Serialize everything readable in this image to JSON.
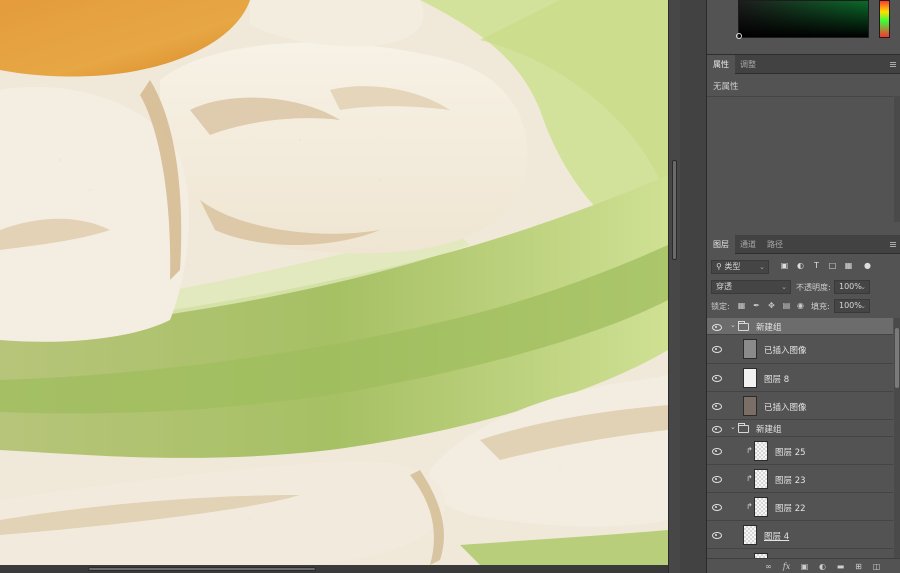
{
  "colors": {
    "panel_bg": "#535353",
    "tab_bar_bg": "#424242",
    "selected_row": "#6c6c6c"
  },
  "properties_panel": {
    "tabs": [
      {
        "label": "属性",
        "active": true
      },
      {
        "label": "调整",
        "active": false
      }
    ],
    "empty_text": "无属性"
  },
  "layers_panel": {
    "tabs": [
      {
        "label": "图层",
        "active": true
      },
      {
        "label": "通道",
        "active": false
      },
      {
        "label": "路径",
        "active": false
      }
    ],
    "filter_kind": "类型",
    "filter_icons": [
      "image-filter-icon",
      "adjustment-filter-icon",
      "type-filter-icon",
      "shape-filter-icon",
      "smart-object-filter-icon",
      "filter-toggle-icon"
    ],
    "blend_mode": "穿透",
    "opacity_label": "不透明度:",
    "opacity_value": "100%",
    "lock_label": "锁定:",
    "lock_icons": [
      "lock-transparent-icon",
      "lock-image-icon",
      "lock-position-icon",
      "lock-artboard-icon",
      "lock-all-icon"
    ],
    "fill_label": "填充:",
    "fill_value": "100%",
    "layers": [
      {
        "name": "新建组",
        "type": "group",
        "expanded": true,
        "selected": true
      },
      {
        "name": "已插入图像",
        "type": "image",
        "thumb": "#8a8a8a"
      },
      {
        "name": "图层 8",
        "type": "image",
        "thumb": "#f2f2f2"
      },
      {
        "name": "已插入图像",
        "type": "image",
        "thumb": "#7a6e66"
      },
      {
        "name": "新建组",
        "type": "group",
        "expanded": true
      },
      {
        "name": "图层 25",
        "type": "clipped"
      },
      {
        "name": "图层 23",
        "type": "clipped"
      },
      {
        "name": "图层 22",
        "type": "clipped"
      },
      {
        "name": "图层 4",
        "type": "image",
        "underline": true
      }
    ],
    "footer_icons": [
      "link-layers-icon",
      "fx-icon",
      "add-mask-icon",
      "adjustment-layer-icon",
      "new-group-icon",
      "new-layer-icon",
      "delete-layer-icon"
    ]
  }
}
